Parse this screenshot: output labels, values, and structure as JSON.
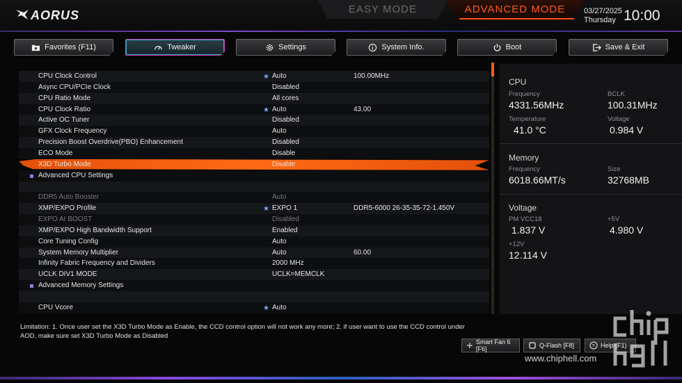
{
  "brand": {
    "name": "AORUS"
  },
  "modes": {
    "easy": "EASY MODE",
    "advanced": "ADVANCED MODE"
  },
  "clock": {
    "date": "03/27/2025",
    "day": "Thursday",
    "time": "10:00"
  },
  "tabs": [
    {
      "label": "Favorites (F11)",
      "icon": "folder-star-icon"
    },
    {
      "label": "Tweaker",
      "icon": "speedometer-icon"
    },
    {
      "label": "Settings",
      "icon": "gear-icon"
    },
    {
      "label": "System Info.",
      "icon": "info-icon"
    },
    {
      "label": "Boot",
      "icon": "power-icon"
    },
    {
      "label": "Save & Exit",
      "icon": "exit-icon"
    }
  ],
  "settings": [
    {
      "label": "CPU Clock Control",
      "star": "★",
      "value": "Auto",
      "extra": "100.00MHz"
    },
    {
      "label": "Async CPU/PCIe Clock",
      "value": "Disabled"
    },
    {
      "label": "CPU Ratio Mode",
      "value": "All cores"
    },
    {
      "label": "CPU Clock Ratio",
      "star": "★",
      "value": "Auto",
      "extra": "43.00"
    },
    {
      "label": "Active OC Tuner",
      "value": "Disabled"
    },
    {
      "label": "GFX Clock Frequency",
      "value": "Auto"
    },
    {
      "label": "Precision Boost Overdrive(PBO) Enhancement",
      "value": "Disabled"
    },
    {
      "label": "ECO Mode",
      "value": "Disable"
    },
    {
      "label": "X3D Turbo Mode",
      "value": "Disable",
      "selected": true
    },
    {
      "label": "Advanced CPU Settings",
      "submenu": true
    },
    {
      "label": ""
    },
    {
      "label": "DDR5 Auto Booster",
      "value": "Auto",
      "dim": true
    },
    {
      "label": "XMP/EXPO Profile",
      "star": "★",
      "value": "EXPO 1",
      "extra": "DDR5-6000 26-35-35-72-1.450V"
    },
    {
      "label": "EXPO AI BOOST",
      "value": "Disabled",
      "dim": true
    },
    {
      "label": "XMP/EXPO High Bandwidth Support",
      "value": "Enabled"
    },
    {
      "label": "Core Tuning Config",
      "value": "Auto"
    },
    {
      "label": "System Memory Multiplier",
      "value": "Auto",
      "extra": "60.00"
    },
    {
      "label": "Infinity Fabric Frequency and Dividers",
      "value": "2000 MHz"
    },
    {
      "label": "UCLK DIV1 MODE",
      "value": "UCLK=MEMCLK"
    },
    {
      "label": "Advanced Memory Settings",
      "submenu": true
    },
    {
      "label": ""
    },
    {
      "label": "CPU Vcore",
      "star": "★",
      "value": "Auto"
    }
  ],
  "info": {
    "cpu": {
      "title": "CPU",
      "freq_label": "Frequency",
      "freq": "4331.56MHz",
      "bclk_label": "BCLK",
      "bclk": "100.31MHz",
      "temp_label": "Temperature",
      "temp": "41.0 °C",
      "volt_label": "Voltage",
      "volt": "0.984 V"
    },
    "memory": {
      "title": "Memory",
      "freq_label": "Frequency",
      "freq": "6018.66MT/s",
      "size_label": "Size",
      "size": "32768MB"
    },
    "voltage": {
      "title": "Voltage",
      "vcc18_label": "PM VCC18",
      "vcc18": "1.837 V",
      "p5_label": "+5V",
      "p5": "4.980 V",
      "p12_label": "+12V",
      "p12": "12.114 V"
    }
  },
  "limitation": "Limitation: 1. Once user set the X3D Turbo Mode as Enable, the CCD control option will not work any more; 2. if user want to use the CCD control under AOD, make sure set X3D Turbo Mode as Disabled",
  "footer_buttons": {
    "smartfan": "Smart Fan 6 [F6]",
    "qflash": "Q-Flash [F8]",
    "help": "Help (F1)"
  },
  "watermark": {
    "url": "www.chiphell.com"
  },
  "colors": {
    "accent": "#ff5a14",
    "selected_row": "#f06010",
    "active_tab_border": "#d43aa8",
    "star": "#7aa6ff"
  }
}
